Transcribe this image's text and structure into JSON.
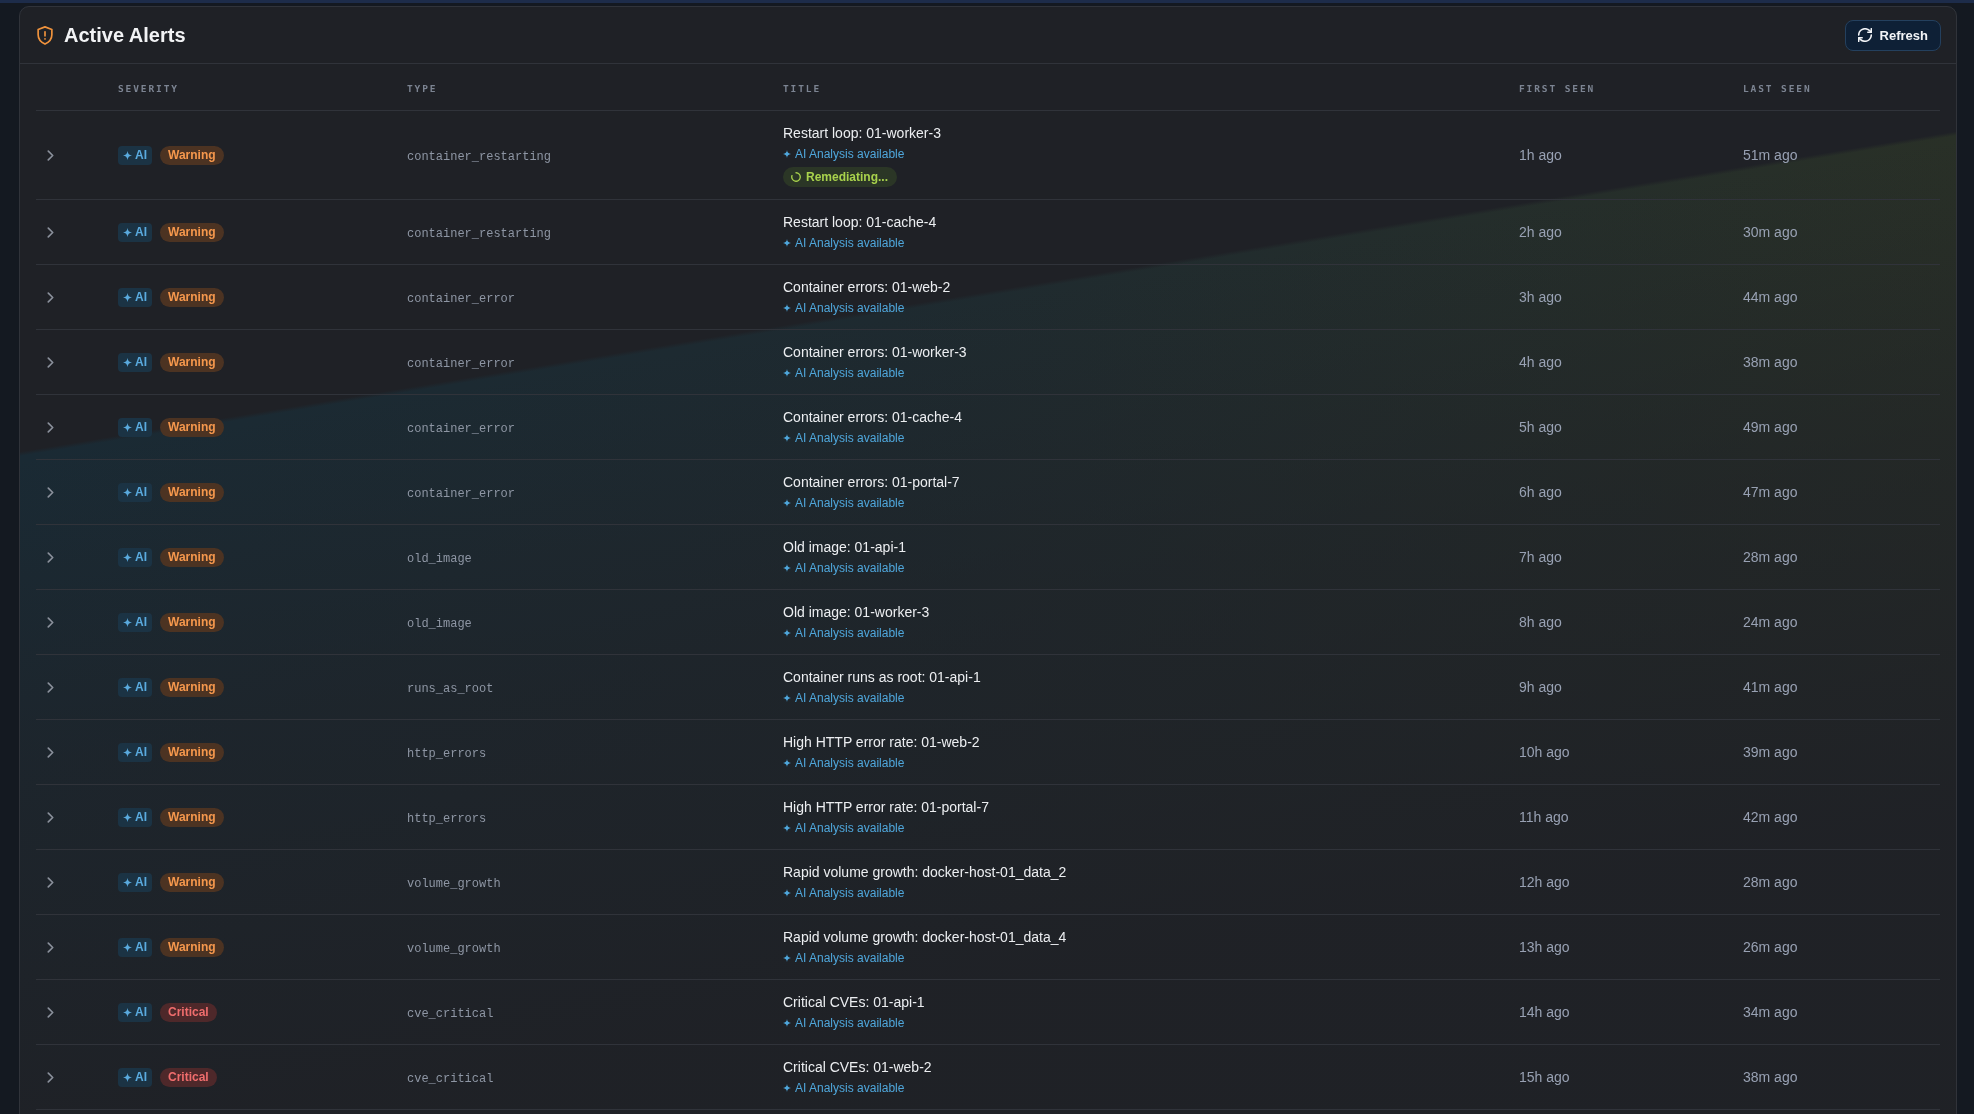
{
  "panel": {
    "title": "Active Alerts",
    "refresh_button": "Refresh"
  },
  "table": {
    "columns": [
      "SEVERITY",
      "TYPE",
      "TITLE",
      "FIRST SEEN",
      "LAST SEEN"
    ],
    "rows": [
      {
        "expanded": false,
        "ai_badge": "AI",
        "severity": {
          "label": "Warning",
          "kind": "warning"
        },
        "type": "container_restarting",
        "title": "Restart loop: 01-worker-3",
        "ai_analysis": "AI Analysis available",
        "status": "Remediating...",
        "first_seen": "1h ago",
        "last_seen": "51m ago"
      },
      {
        "expanded": false,
        "ai_badge": "AI",
        "severity": {
          "label": "Warning",
          "kind": "warning"
        },
        "type": "container_restarting",
        "title": "Restart loop: 01-cache-4",
        "ai_analysis": "AI Analysis available",
        "first_seen": "2h ago",
        "last_seen": "30m ago"
      },
      {
        "expanded": false,
        "ai_badge": "AI",
        "severity": {
          "label": "Warning",
          "kind": "warning"
        },
        "type": "container_error",
        "title": "Container errors: 01-web-2",
        "ai_analysis": "AI Analysis available",
        "first_seen": "3h ago",
        "last_seen": "44m ago"
      },
      {
        "expanded": false,
        "ai_badge": "AI",
        "severity": {
          "label": "Warning",
          "kind": "warning"
        },
        "type": "container_error",
        "title": "Container errors: 01-worker-3",
        "ai_analysis": "AI Analysis available",
        "first_seen": "4h ago",
        "last_seen": "38m ago"
      },
      {
        "expanded": false,
        "ai_badge": "AI",
        "severity": {
          "label": "Warning",
          "kind": "warning"
        },
        "type": "container_error",
        "title": "Container errors: 01-cache-4",
        "ai_analysis": "AI Analysis available",
        "first_seen": "5h ago",
        "last_seen": "49m ago"
      },
      {
        "expanded": false,
        "ai_badge": "AI",
        "severity": {
          "label": "Warning",
          "kind": "warning"
        },
        "type": "container_error",
        "title": "Container errors: 01-portal-7",
        "ai_analysis": "AI Analysis available",
        "first_seen": "6h ago",
        "last_seen": "47m ago"
      },
      {
        "expanded": false,
        "ai_badge": "AI",
        "severity": {
          "label": "Warning",
          "kind": "warning"
        },
        "type": "old_image",
        "title": "Old image: 01-api-1",
        "ai_analysis": "AI Analysis available",
        "first_seen": "7h ago",
        "last_seen": "28m ago"
      },
      {
        "expanded": false,
        "ai_badge": "AI",
        "severity": {
          "label": "Warning",
          "kind": "warning"
        },
        "type": "old_image",
        "title": "Old image: 01-worker-3",
        "ai_analysis": "AI Analysis available",
        "first_seen": "8h ago",
        "last_seen": "24m ago"
      },
      {
        "expanded": false,
        "ai_badge": "AI",
        "severity": {
          "label": "Warning",
          "kind": "warning"
        },
        "type": "runs_as_root",
        "title": "Container runs as root: 01-api-1",
        "ai_analysis": "AI Analysis available",
        "first_seen": "9h ago",
        "last_seen": "41m ago"
      },
      {
        "expanded": false,
        "ai_badge": "AI",
        "severity": {
          "label": "Warning",
          "kind": "warning"
        },
        "type": "http_errors",
        "title": "High HTTP error rate: 01-web-2",
        "ai_analysis": "AI Analysis available",
        "first_seen": "10h ago",
        "last_seen": "39m ago"
      },
      {
        "expanded": false,
        "ai_badge": "AI",
        "severity": {
          "label": "Warning",
          "kind": "warning"
        },
        "type": "http_errors",
        "title": "High HTTP error rate: 01-portal-7",
        "ai_analysis": "AI Analysis available",
        "first_seen": "11h ago",
        "last_seen": "42m ago"
      },
      {
        "expanded": false,
        "ai_badge": "AI",
        "severity": {
          "label": "Warning",
          "kind": "warning"
        },
        "type": "volume_growth",
        "title": "Rapid volume growth: docker-host-01_data_2",
        "ai_analysis": "AI Analysis available",
        "first_seen": "12h ago",
        "last_seen": "28m ago"
      },
      {
        "expanded": false,
        "ai_badge": "AI",
        "severity": {
          "label": "Warning",
          "kind": "warning"
        },
        "type": "volume_growth",
        "title": "Rapid volume growth: docker-host-01_data_4",
        "ai_analysis": "AI Analysis available",
        "first_seen": "13h ago",
        "last_seen": "26m ago"
      },
      {
        "expanded": false,
        "ai_badge": "AI",
        "severity": {
          "label": "Critical",
          "kind": "critical"
        },
        "type": "cve_critical",
        "title": "Critical CVEs: 01-api-1",
        "ai_analysis": "AI Analysis available",
        "first_seen": "14h ago",
        "last_seen": "34m ago"
      },
      {
        "expanded": false,
        "ai_badge": "AI",
        "severity": {
          "label": "Critical",
          "kind": "critical"
        },
        "type": "cve_critical",
        "title": "Critical CVEs: 01-web-2",
        "ai_analysis": "AI Analysis available",
        "first_seen": "15h ago",
        "last_seen": "38m ago"
      }
    ]
  }
}
